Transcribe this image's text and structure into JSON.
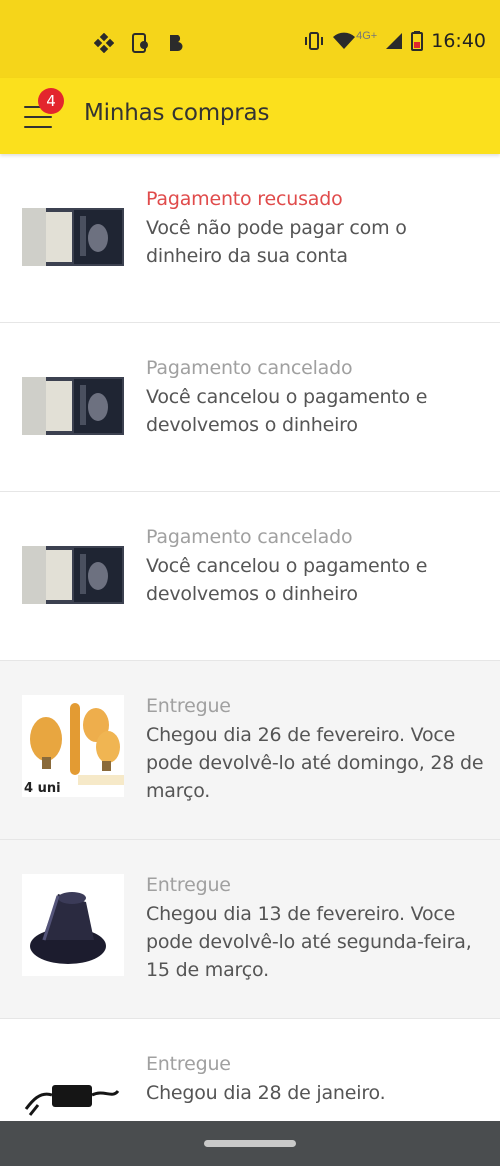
{
  "status_bar": {
    "time": "16:40",
    "network_label": "4G+",
    "left_icons": [
      "binance-icon",
      "phone-update-icon",
      "b-app-icon"
    ],
    "right_icons": [
      "vibrate-icon",
      "wifi-icon",
      "signal-icon",
      "battery-icon"
    ]
  },
  "app_bar": {
    "title": "Minhas compras",
    "menu_badge": "4",
    "background": "#fbe01d"
  },
  "colors": {
    "status_refused": "#e04b4b",
    "status_neutral": "#a0a0a0",
    "description": "#555555",
    "delivered_background": "#f5f5f5"
  },
  "purchases": [
    {
      "status": "Pagamento recusado",
      "description": "Você não pode pagar com o dinheiro da sua conta",
      "thumbnail": "router-product-photo",
      "status_kind": "refused"
    },
    {
      "status": "Pagamento cancelado",
      "description": "Você cancelou o pagamento e devolvemos o dinheiro",
      "thumbnail": "router-product-photo",
      "status_kind": "cancelled"
    },
    {
      "status": "Pagamento cancelado",
      "description": "Você cancelou o pagamento e devolvemos o dinheiro",
      "thumbnail": "router-product-photo",
      "status_kind": "cancelled"
    },
    {
      "status": "Entregue",
      "description": "Chegou dia 26 de fevereiro. Voce pode devolvê-lo até domingo, 28 de março.",
      "thumbnail": "filament-bulbs-photo",
      "thumbnail_caption": "4 uni",
      "status_kind": "delivered"
    },
    {
      "status": "Entregue",
      "description": "Chegou dia 13 de fevereiro. Voce pode devolvê-lo até segunda-feira, 15 de março.",
      "thumbnail": "rubber-pad-photo",
      "status_kind": "delivered"
    },
    {
      "status": "Entregue",
      "description": "Chegou dia 28 de janeiro.",
      "thumbnail": "power-adapter-photo",
      "status_kind": "delivered"
    }
  ]
}
